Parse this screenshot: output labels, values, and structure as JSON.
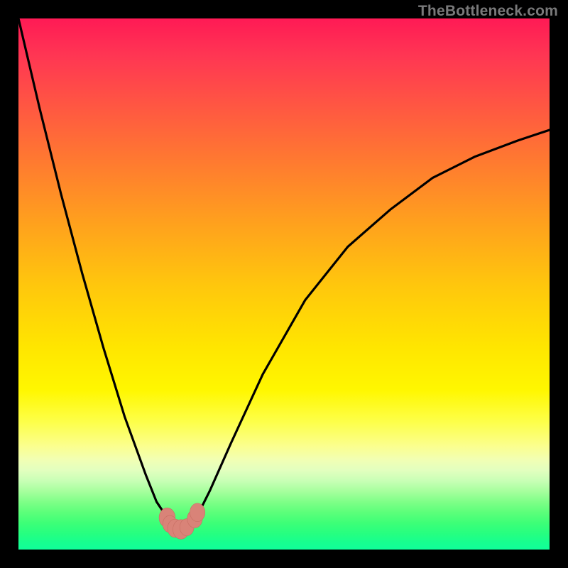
{
  "watermark": "TheBottleneck.com",
  "colors": {
    "page_bg": "#000000",
    "curve_stroke": "#000000",
    "marker_fill": "#d98378",
    "marker_stroke": "#c76e63",
    "watermark": "#79797a"
  },
  "chart_data": {
    "type": "line",
    "title": "",
    "xlabel": "",
    "ylabel": "",
    "xlim": [
      0,
      100
    ],
    "ylim": [
      0,
      100
    ],
    "grid": false,
    "legend": false,
    "note": "Axes are unlabeled in the source image; x maps left→right, y maps bottom→top. Values estimated from pixel positions and rounded to the nearest integer.",
    "series": [
      {
        "name": "curve",
        "x": [
          0,
          4,
          8,
          12,
          16,
          20,
          24,
          26,
          28,
          29,
          30,
          31,
          32,
          33,
          34,
          36,
          40,
          46,
          54,
          62,
          70,
          78,
          86,
          94,
          100
        ],
        "y": [
          100,
          83,
          67,
          52,
          38,
          25,
          14,
          9,
          6,
          4,
          4,
          4,
          4,
          5,
          7,
          11,
          20,
          33,
          47,
          57,
          64,
          70,
          74,
          77,
          79
        ]
      }
    ],
    "markers": [
      {
        "cx": 28.0,
        "cy": 6.0,
        "r": 1.6
      },
      {
        "cx": 28.5,
        "cy": 4.8,
        "r": 1.4
      },
      {
        "cx": 29.5,
        "cy": 4.0,
        "r": 1.5
      },
      {
        "cx": 30.6,
        "cy": 3.8,
        "r": 1.6
      },
      {
        "cx": 31.7,
        "cy": 4.2,
        "r": 1.4
      },
      {
        "cx": 33.2,
        "cy": 5.8,
        "r": 1.5
      },
      {
        "cx": 33.7,
        "cy": 7.0,
        "r": 1.5
      }
    ]
  }
}
